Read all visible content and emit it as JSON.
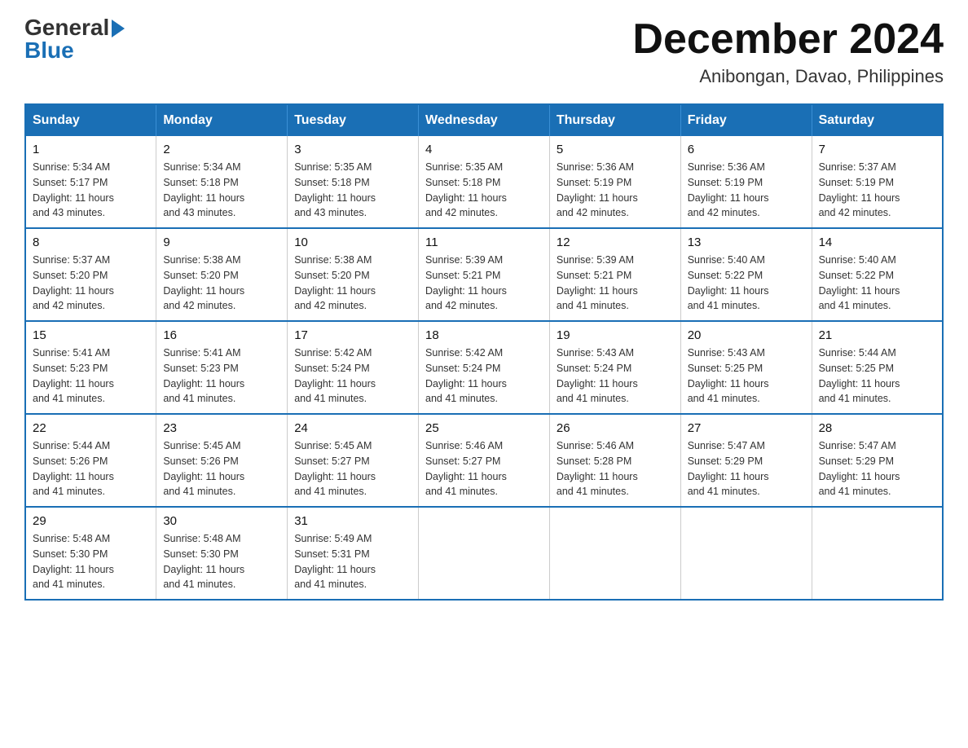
{
  "logo": {
    "general": "General",
    "arrow": "▶",
    "blue": "Blue"
  },
  "header": {
    "title": "December 2024",
    "subtitle": "Anibongan, Davao, Philippines"
  },
  "weekdays": [
    "Sunday",
    "Monday",
    "Tuesday",
    "Wednesday",
    "Thursday",
    "Friday",
    "Saturday"
  ],
  "weeks": [
    [
      {
        "day": "1",
        "sunrise": "5:34 AM",
        "sunset": "5:17 PM",
        "daylight": "11 hours and 43 minutes."
      },
      {
        "day": "2",
        "sunrise": "5:34 AM",
        "sunset": "5:18 PM",
        "daylight": "11 hours and 43 minutes."
      },
      {
        "day": "3",
        "sunrise": "5:35 AM",
        "sunset": "5:18 PM",
        "daylight": "11 hours and 43 minutes."
      },
      {
        "day": "4",
        "sunrise": "5:35 AM",
        "sunset": "5:18 PM",
        "daylight": "11 hours and 42 minutes."
      },
      {
        "day": "5",
        "sunrise": "5:36 AM",
        "sunset": "5:19 PM",
        "daylight": "11 hours and 42 minutes."
      },
      {
        "day": "6",
        "sunrise": "5:36 AM",
        "sunset": "5:19 PM",
        "daylight": "11 hours and 42 minutes."
      },
      {
        "day": "7",
        "sunrise": "5:37 AM",
        "sunset": "5:19 PM",
        "daylight": "11 hours and 42 minutes."
      }
    ],
    [
      {
        "day": "8",
        "sunrise": "5:37 AM",
        "sunset": "5:20 PM",
        "daylight": "11 hours and 42 minutes."
      },
      {
        "day": "9",
        "sunrise": "5:38 AM",
        "sunset": "5:20 PM",
        "daylight": "11 hours and 42 minutes."
      },
      {
        "day": "10",
        "sunrise": "5:38 AM",
        "sunset": "5:20 PM",
        "daylight": "11 hours and 42 minutes."
      },
      {
        "day": "11",
        "sunrise": "5:39 AM",
        "sunset": "5:21 PM",
        "daylight": "11 hours and 42 minutes."
      },
      {
        "day": "12",
        "sunrise": "5:39 AM",
        "sunset": "5:21 PM",
        "daylight": "11 hours and 41 minutes."
      },
      {
        "day": "13",
        "sunrise": "5:40 AM",
        "sunset": "5:22 PM",
        "daylight": "11 hours and 41 minutes."
      },
      {
        "day": "14",
        "sunrise": "5:40 AM",
        "sunset": "5:22 PM",
        "daylight": "11 hours and 41 minutes."
      }
    ],
    [
      {
        "day": "15",
        "sunrise": "5:41 AM",
        "sunset": "5:23 PM",
        "daylight": "11 hours and 41 minutes."
      },
      {
        "day": "16",
        "sunrise": "5:41 AM",
        "sunset": "5:23 PM",
        "daylight": "11 hours and 41 minutes."
      },
      {
        "day": "17",
        "sunrise": "5:42 AM",
        "sunset": "5:24 PM",
        "daylight": "11 hours and 41 minutes."
      },
      {
        "day": "18",
        "sunrise": "5:42 AM",
        "sunset": "5:24 PM",
        "daylight": "11 hours and 41 minutes."
      },
      {
        "day": "19",
        "sunrise": "5:43 AM",
        "sunset": "5:24 PM",
        "daylight": "11 hours and 41 minutes."
      },
      {
        "day": "20",
        "sunrise": "5:43 AM",
        "sunset": "5:25 PM",
        "daylight": "11 hours and 41 minutes."
      },
      {
        "day": "21",
        "sunrise": "5:44 AM",
        "sunset": "5:25 PM",
        "daylight": "11 hours and 41 minutes."
      }
    ],
    [
      {
        "day": "22",
        "sunrise": "5:44 AM",
        "sunset": "5:26 PM",
        "daylight": "11 hours and 41 minutes."
      },
      {
        "day": "23",
        "sunrise": "5:45 AM",
        "sunset": "5:26 PM",
        "daylight": "11 hours and 41 minutes."
      },
      {
        "day": "24",
        "sunrise": "5:45 AM",
        "sunset": "5:27 PM",
        "daylight": "11 hours and 41 minutes."
      },
      {
        "day": "25",
        "sunrise": "5:46 AM",
        "sunset": "5:27 PM",
        "daylight": "11 hours and 41 minutes."
      },
      {
        "day": "26",
        "sunrise": "5:46 AM",
        "sunset": "5:28 PM",
        "daylight": "11 hours and 41 minutes."
      },
      {
        "day": "27",
        "sunrise": "5:47 AM",
        "sunset": "5:29 PM",
        "daylight": "11 hours and 41 minutes."
      },
      {
        "day": "28",
        "sunrise": "5:47 AM",
        "sunset": "5:29 PM",
        "daylight": "11 hours and 41 minutes."
      }
    ],
    [
      {
        "day": "29",
        "sunrise": "5:48 AM",
        "sunset": "5:30 PM",
        "daylight": "11 hours and 41 minutes."
      },
      {
        "day": "30",
        "sunrise": "5:48 AM",
        "sunset": "5:30 PM",
        "daylight": "11 hours and 41 minutes."
      },
      {
        "day": "31",
        "sunrise": "5:49 AM",
        "sunset": "5:31 PM",
        "daylight": "11 hours and 41 minutes."
      },
      null,
      null,
      null,
      null
    ]
  ],
  "labels": {
    "sunrise": "Sunrise:",
    "sunset": "Sunset:",
    "daylight": "Daylight:"
  }
}
